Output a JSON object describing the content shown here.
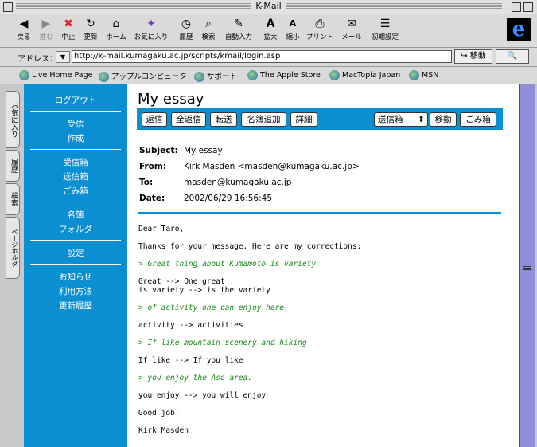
{
  "window": {
    "title": "K-Mail"
  },
  "toolbar": {
    "buttons": [
      "戻る",
      "進む",
      "中止",
      "更新",
      "ホーム",
      "お気に入り",
      "履歴",
      "検索",
      "自動入力",
      "拡大",
      "縮小",
      "プリント",
      "メール",
      "初期設定"
    ],
    "icons": [
      "back-arrow",
      "forward-arrow",
      "stop",
      "refresh",
      "home",
      "favorites",
      "history",
      "search",
      "autofill",
      "zoom-in",
      "zoom-out",
      "print",
      "mail",
      "preferences"
    ]
  },
  "address": {
    "label": "アドレス：",
    "url": "http://k-mail.kumagaku.ac.jp/scripts/kmail/login.asp",
    "go_label": "移動"
  },
  "favorites": [
    "Live Home Page",
    "アップルコンピュータ",
    "サポート",
    "The Apple Store",
    "MacTopia Japan",
    "MSN"
  ],
  "side_tabs": [
    "お気に入り",
    "履歴",
    "検索",
    "スクラップブック",
    "ページホルダ"
  ],
  "nav": {
    "logout": "ログアウト",
    "group1": [
      "受信",
      "作成"
    ],
    "group2": [
      "受信箱",
      "送信箱",
      "ごみ箱"
    ],
    "group3": [
      "名簿",
      "フォルダ"
    ],
    "group4": [
      "設定"
    ],
    "group5": [
      "お知らせ",
      "利用方法",
      "更新履歴"
    ]
  },
  "message": {
    "page_title": "My essay",
    "actions": [
      "返信",
      "全返信",
      "転送",
      "名簿追加",
      "詳細"
    ],
    "folder_select": "送信箱",
    "move_label": "移動",
    "trash_label": "ごみ箱",
    "headers": {
      "subject_label": "Subject:",
      "subject": "My essay",
      "from_label": "From:",
      "from": "Kirk Masden <masden@kumagaku.ac.jp>",
      "to_label": "To:",
      "to": "masden@kumagaku.ac.jp",
      "date_label": "Date:",
      "date": "2002/06/29 16:56:45"
    },
    "body": [
      {
        "text": "Dear Taro,",
        "quote": false
      },
      {
        "text": "Thanks for your message. Here are my corrections:",
        "quote": false
      },
      {
        "text": "> Great thing about Kumamoto is variety",
        "quote": true
      },
      {
        "text": "Great --> One great",
        "quote": false
      },
      {
        "text": "is variety --> is the variety",
        "quote": false
      },
      {
        "text": "> of activity one can enjoy here.",
        "quote": true
      },
      {
        "text": "activity --> activities",
        "quote": false
      },
      {
        "text": "> If like mountain scenery and hiking",
        "quote": true
      },
      {
        "text": "If like --> If you like",
        "quote": false
      },
      {
        "text": "> you enjoy the Aso area.",
        "quote": true
      },
      {
        "text": "you enjoy --> you will enjoy",
        "quote": false
      },
      {
        "text": "Good job!",
        "quote": false
      },
      {
        "text": "Kirk Masden",
        "quote": false
      }
    ]
  },
  "colors": {
    "accent": "#0b8fd2",
    "quote": "#1a8a1a",
    "scrollbar": "#8f8fd8"
  }
}
